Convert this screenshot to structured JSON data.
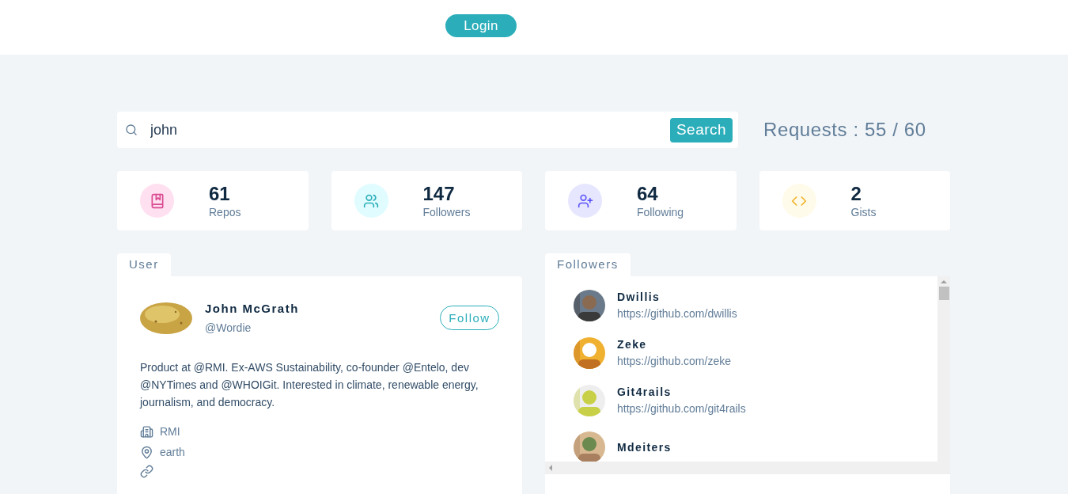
{
  "header": {
    "login_button": "Login"
  },
  "search": {
    "value": "john",
    "button": "Search",
    "requests": "Requests : 55 / 60"
  },
  "stats": [
    {
      "kind": "repos",
      "value": "61",
      "label": "Repos"
    },
    {
      "kind": "followers",
      "value": "147",
      "label": "Followers"
    },
    {
      "kind": "following",
      "value": "64",
      "label": "Following"
    },
    {
      "kind": "gists",
      "value": "2",
      "label": "Gists"
    }
  ],
  "user": {
    "tab": "User",
    "name": "John McGrath",
    "handle": "@Wordie",
    "follow_button": "Follow",
    "bio": "Product at @RMI. Ex-AWS Sustainability, co-founder @Entelo, dev @NYTimes and @WHOIGit. Interested in climate, renewable energy, journalism, and democracy.",
    "company": "RMI",
    "location": "earth"
  },
  "followers": {
    "tab": "Followers",
    "items": [
      {
        "name": "Dwillis",
        "url": "https://github.com/dwillis"
      },
      {
        "name": "Zeke",
        "url": "https://github.com/zeke"
      },
      {
        "name": "Git4rails",
        "url": "https://github.com/git4rails"
      },
      {
        "name": "Mdeiters"
      }
    ]
  }
}
